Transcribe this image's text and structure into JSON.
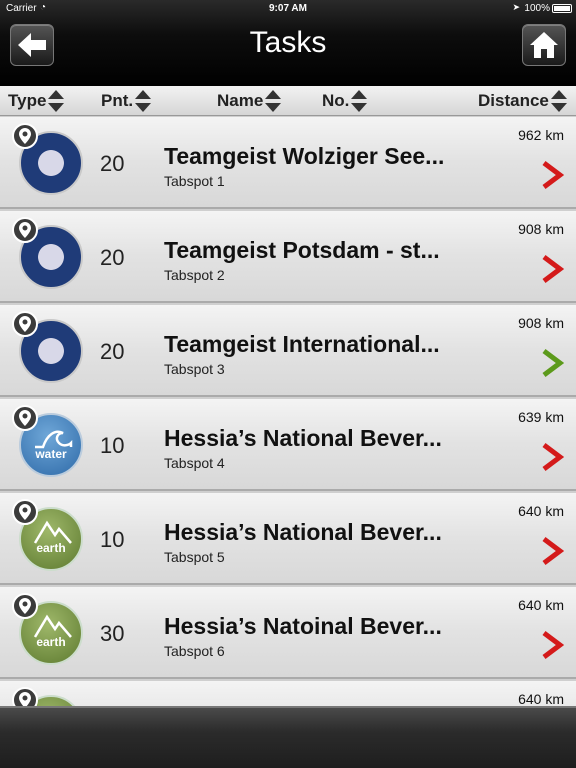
{
  "status": {
    "carrier": "Carrier",
    "time": "9:07 AM",
    "battery": "100%"
  },
  "nav": {
    "title": "Tasks",
    "back_icon": "arrow-left-icon",
    "home_icon": "home-icon"
  },
  "columns": {
    "type": "Type",
    "points": "Pnt.",
    "name": "Name",
    "number": "No.",
    "distance": "Distance"
  },
  "colors": {
    "chevron_red": "#d41a1a",
    "chevron_green": "#5c9a1b"
  },
  "tasks": [
    {
      "badge": "cross",
      "badge_label": "",
      "points": "20",
      "name": "Teamgeist Wolziger See...",
      "subtitle": "Tabspot 1",
      "distance": "962 km",
      "chevron": "red"
    },
    {
      "badge": "cross",
      "badge_label": "",
      "points": "20",
      "name": "Teamgeist Potsdam - st...",
      "subtitle": "Tabspot 2",
      "distance": "908 km",
      "chevron": "red"
    },
    {
      "badge": "cross",
      "badge_label": "",
      "points": "20",
      "name": "Teamgeist International...",
      "subtitle": "Tabspot 3",
      "distance": "908 km",
      "chevron": "green"
    },
    {
      "badge": "water",
      "badge_label": "water",
      "points": "10",
      "name": "Hessia’s National Bever...",
      "subtitle": "Tabspot 4",
      "distance": "639 km",
      "chevron": "red"
    },
    {
      "badge": "earth",
      "badge_label": "earth",
      "points": "10",
      "name": "Hessia’s National Bever...",
      "subtitle": "Tabspot 5",
      "distance": "640 km",
      "chevron": "red"
    },
    {
      "badge": "earth",
      "badge_label": "earth",
      "points": "30",
      "name": "Hessia’s Natoinal Bever...",
      "subtitle": "Tabspot 6",
      "distance": "640 km",
      "chevron": "red"
    },
    {
      "badge": "earth",
      "badge_label": "",
      "points": "",
      "name": "",
      "subtitle": "",
      "distance": "640 km",
      "chevron": "red"
    }
  ]
}
